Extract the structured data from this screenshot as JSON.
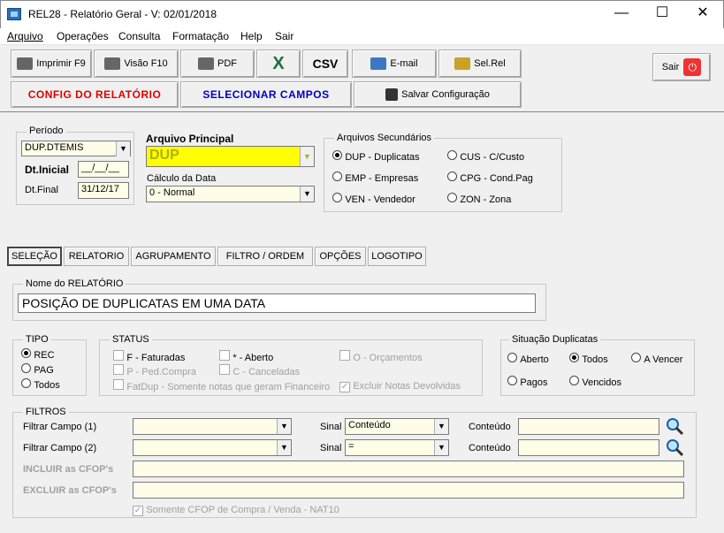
{
  "window": {
    "title": "REL28 - Relatório Geral - V: 02/01/2018",
    "minimize": "—",
    "maximize": "☐",
    "close": "✕"
  },
  "menu": [
    "Arquivo",
    "Operações",
    "Consulta",
    "Formatação",
    "Help",
    "Sair"
  ],
  "toolbar": {
    "imprimir": "Imprimir F9",
    "visao": "Visão F10",
    "pdf": "PDF",
    "excel": "X",
    "csv": "CSV",
    "email": "E-mail",
    "selrel": "Sel.Rel",
    "sair": "Sair",
    "config": "CONFIG  DO  RELATÓRIO",
    "selecionar": "SELECIONAR  CAMPOS",
    "salvar": "Salvar Configuração"
  },
  "periodo": {
    "label": "Período",
    "campo": "DUP.DTEMIS",
    "dtinicial_label": "Dt.Inicial",
    "dtinicial": "__/__/__",
    "dtfinal_label": "Dt.Final",
    "dtfinal": "31/12/17"
  },
  "arquivo_principal": {
    "label": "Arquivo Principal",
    "value": "DUP"
  },
  "calculo": {
    "label": "Cálculo da Data",
    "value": "0 - Normal"
  },
  "secundarios": {
    "label": "Arquivos Secundários",
    "items": [
      "DUP - Duplicatas",
      "EMP - Empresas",
      "VEN - Vendedor",
      "CUS - C/Custo",
      "CPG - Cond.Pag",
      "ZON - Zona"
    ]
  },
  "tabs": [
    "SELEÇÃO",
    "RELATORIO",
    "AGRUPAMENTO",
    "FILTRO / ORDEM",
    "OPÇÕES",
    "LOGOTIPO"
  ],
  "nome": {
    "label": "Nome do RELATÓRIO",
    "value": "POSIÇÃO DE DUPLICATAS EM UMA DATA"
  },
  "tipo": {
    "label": "TIPO",
    "items": [
      "REC",
      "PAG",
      "Todos"
    ]
  },
  "status": {
    "label": "STATUS",
    "items": [
      "F - Faturadas",
      "P - Ped.Compra",
      "FatDup - Somente notas que geram Financeiro",
      "* - Aberto",
      "C - Canceladas",
      "O - Orçamentos",
      "Excluir Notas Devolvidas"
    ]
  },
  "situacao": {
    "label": "Situação Duplicatas",
    "items": [
      "Aberto",
      "Todos",
      "A Vencer",
      "Pagos",
      "Vencidos"
    ]
  },
  "filtros": {
    "label": "FILTROS",
    "campo1": "Filtrar Campo (1)",
    "campo2": "Filtrar Campo (2)",
    "sinal": "Sinal",
    "sinal1": "Conteúdo",
    "sinal2": "=",
    "conteudo": "Conteúdo",
    "incluir": "INCLUIR  as CFOP's",
    "excluir": "EXCLUIR  as CFOP's",
    "somente": "Somente CFOP de  Compra / Venda - NAT10"
  }
}
